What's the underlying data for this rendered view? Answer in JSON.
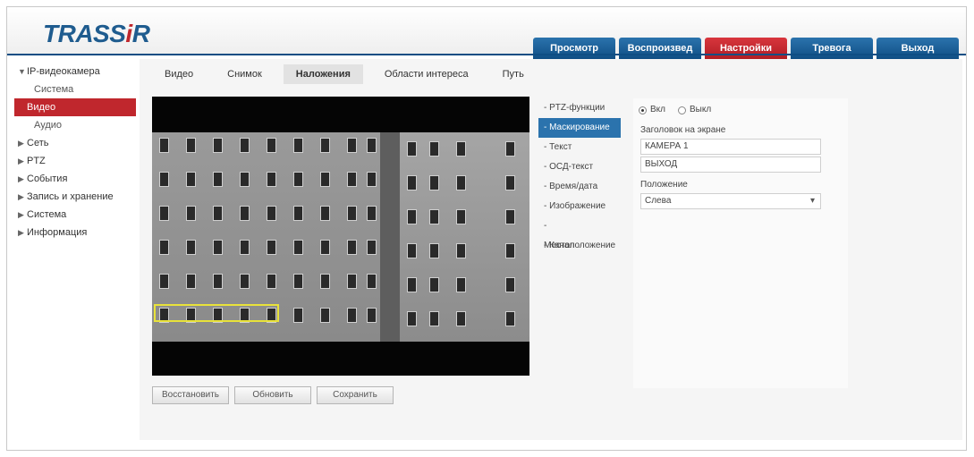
{
  "header": {
    "logo_main": "TRASS",
    "logo_i": "i",
    "logo_r": "R",
    "tabs": [
      {
        "label": "Просмотр"
      },
      {
        "label": "Воспроизвед"
      },
      {
        "label": "Настройки"
      },
      {
        "label": "Тревога"
      },
      {
        "label": "Выход"
      }
    ]
  },
  "sidebar": {
    "items": [
      {
        "label": "IP-видеокамера"
      },
      {
        "label": "Система"
      },
      {
        "label": "Видео"
      },
      {
        "label": "Аудио"
      },
      {
        "label": "Сеть"
      },
      {
        "label": "PTZ"
      },
      {
        "label": "События"
      },
      {
        "label": "Запись и хранение"
      },
      {
        "label": "Система"
      },
      {
        "label": "Информация"
      }
    ]
  },
  "subtabs": [
    {
      "label": "Видео"
    },
    {
      "label": "Снимок"
    },
    {
      "label": "Наложения"
    },
    {
      "label": "Области интереса"
    },
    {
      "label": "Путь"
    }
  ],
  "video_buttons": [
    {
      "label": "Восстановить"
    },
    {
      "label": "Обновить"
    },
    {
      "label": "Сохранить"
    }
  ],
  "osd_menu": [
    {
      "label": "- PTZ-функции"
    },
    {
      "label": "- Маскирование"
    },
    {
      "label": "- Текст"
    },
    {
      "label": "- ОСД-текст"
    },
    {
      "label": "- Время/дата"
    },
    {
      "label": "- Изображение"
    },
    {
      "label": "- Местоположение"
    },
    {
      "label": "- Канал"
    }
  ],
  "params": {
    "radio_on": "Вкл",
    "radio_off": "Выкл",
    "title_label": "Заголовок на экране",
    "title_value": "КАМЕРА 1",
    "title_value2": "ВЫХОД",
    "position_label": "Положение",
    "position_value": "Слева"
  },
  "colors": {
    "accent_blue": "#0f4e84",
    "accent_red": "#c0272d",
    "roi_yellow": "#e8e23a"
  }
}
